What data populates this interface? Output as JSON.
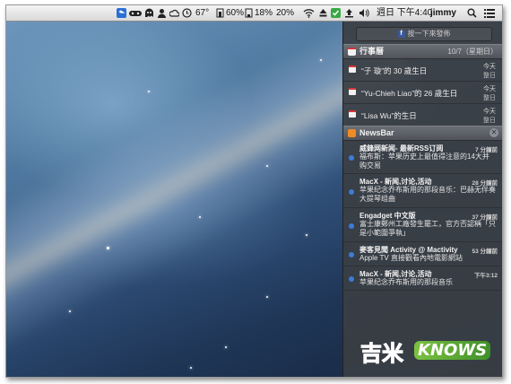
{
  "menubar": {
    "battery_percent": "67°",
    "cpu_percent": "60%",
    "mem_percent": "18%",
    "net_percent": "20%",
    "clock": "週日 下午4:40",
    "user": "jimmy",
    "icons": [
      "dropbox-icon",
      "gamepad-icon",
      "ghost-icon",
      "user-icon",
      "cloud-icon",
      "clock-icon",
      "wifi-icon",
      "eject-icon",
      "check-icon",
      "upload-icon",
      "volume-icon",
      "search-icon",
      "list-icon"
    ]
  },
  "notification_center": {
    "share_button": "按一下來發佈",
    "calendar": {
      "title": "行事曆",
      "date": "10/7（星期日）",
      "items": [
        {
          "text": "“子 璇”的 30 歲生日",
          "day": "今天",
          "time": "整日"
        },
        {
          "text": "“Yu-Chieh Liao”的 26 歲生日",
          "day": "今天",
          "time": "整日"
        },
        {
          "text": "“Lisa Wu”的生日",
          "day": "今天",
          "time": "整日"
        }
      ]
    },
    "newsbar": {
      "title": "NewsBar",
      "close": "✕",
      "items": [
        {
          "title": "威鋒网新闻- 最新RSS订阅",
          "time": "7 分鐘前",
          "body": "福布斯：苹果历史上最值得注意的14大并购交易"
        },
        {
          "title": "MacX - 新闻,讨论,活动",
          "time": "28 分鐘前",
          "body": "苹果纪念乔布斯用的那段音乐：巴赫无伴奏大提琴组曲"
        },
        {
          "title": "Engadget 中文版",
          "time": "37 分鐘前",
          "body": "富士康鄭州工廠發生罷工，官方否認稱「只是小範圍爭執」"
        },
        {
          "title": "麥客見聞 Activity @ Mactivity",
          "time": "53 分鐘前",
          "body": "Apple TV 直接觀看內地電影網站"
        },
        {
          "title": "MacX - 新闻,讨论,活动",
          "time": "下午3:12",
          "body": "苹果纪念乔布斯用的那段音乐"
        }
      ]
    }
  },
  "watermark": {
    "chinese": "吉米",
    "english": "KNOWS"
  },
  "colors": {
    "unread_dot": "#3d7bd9",
    "panel_bg": "#3a3e44",
    "watermark_cyan": "#5fd0e8",
    "watermark_green": "#7cc242"
  }
}
